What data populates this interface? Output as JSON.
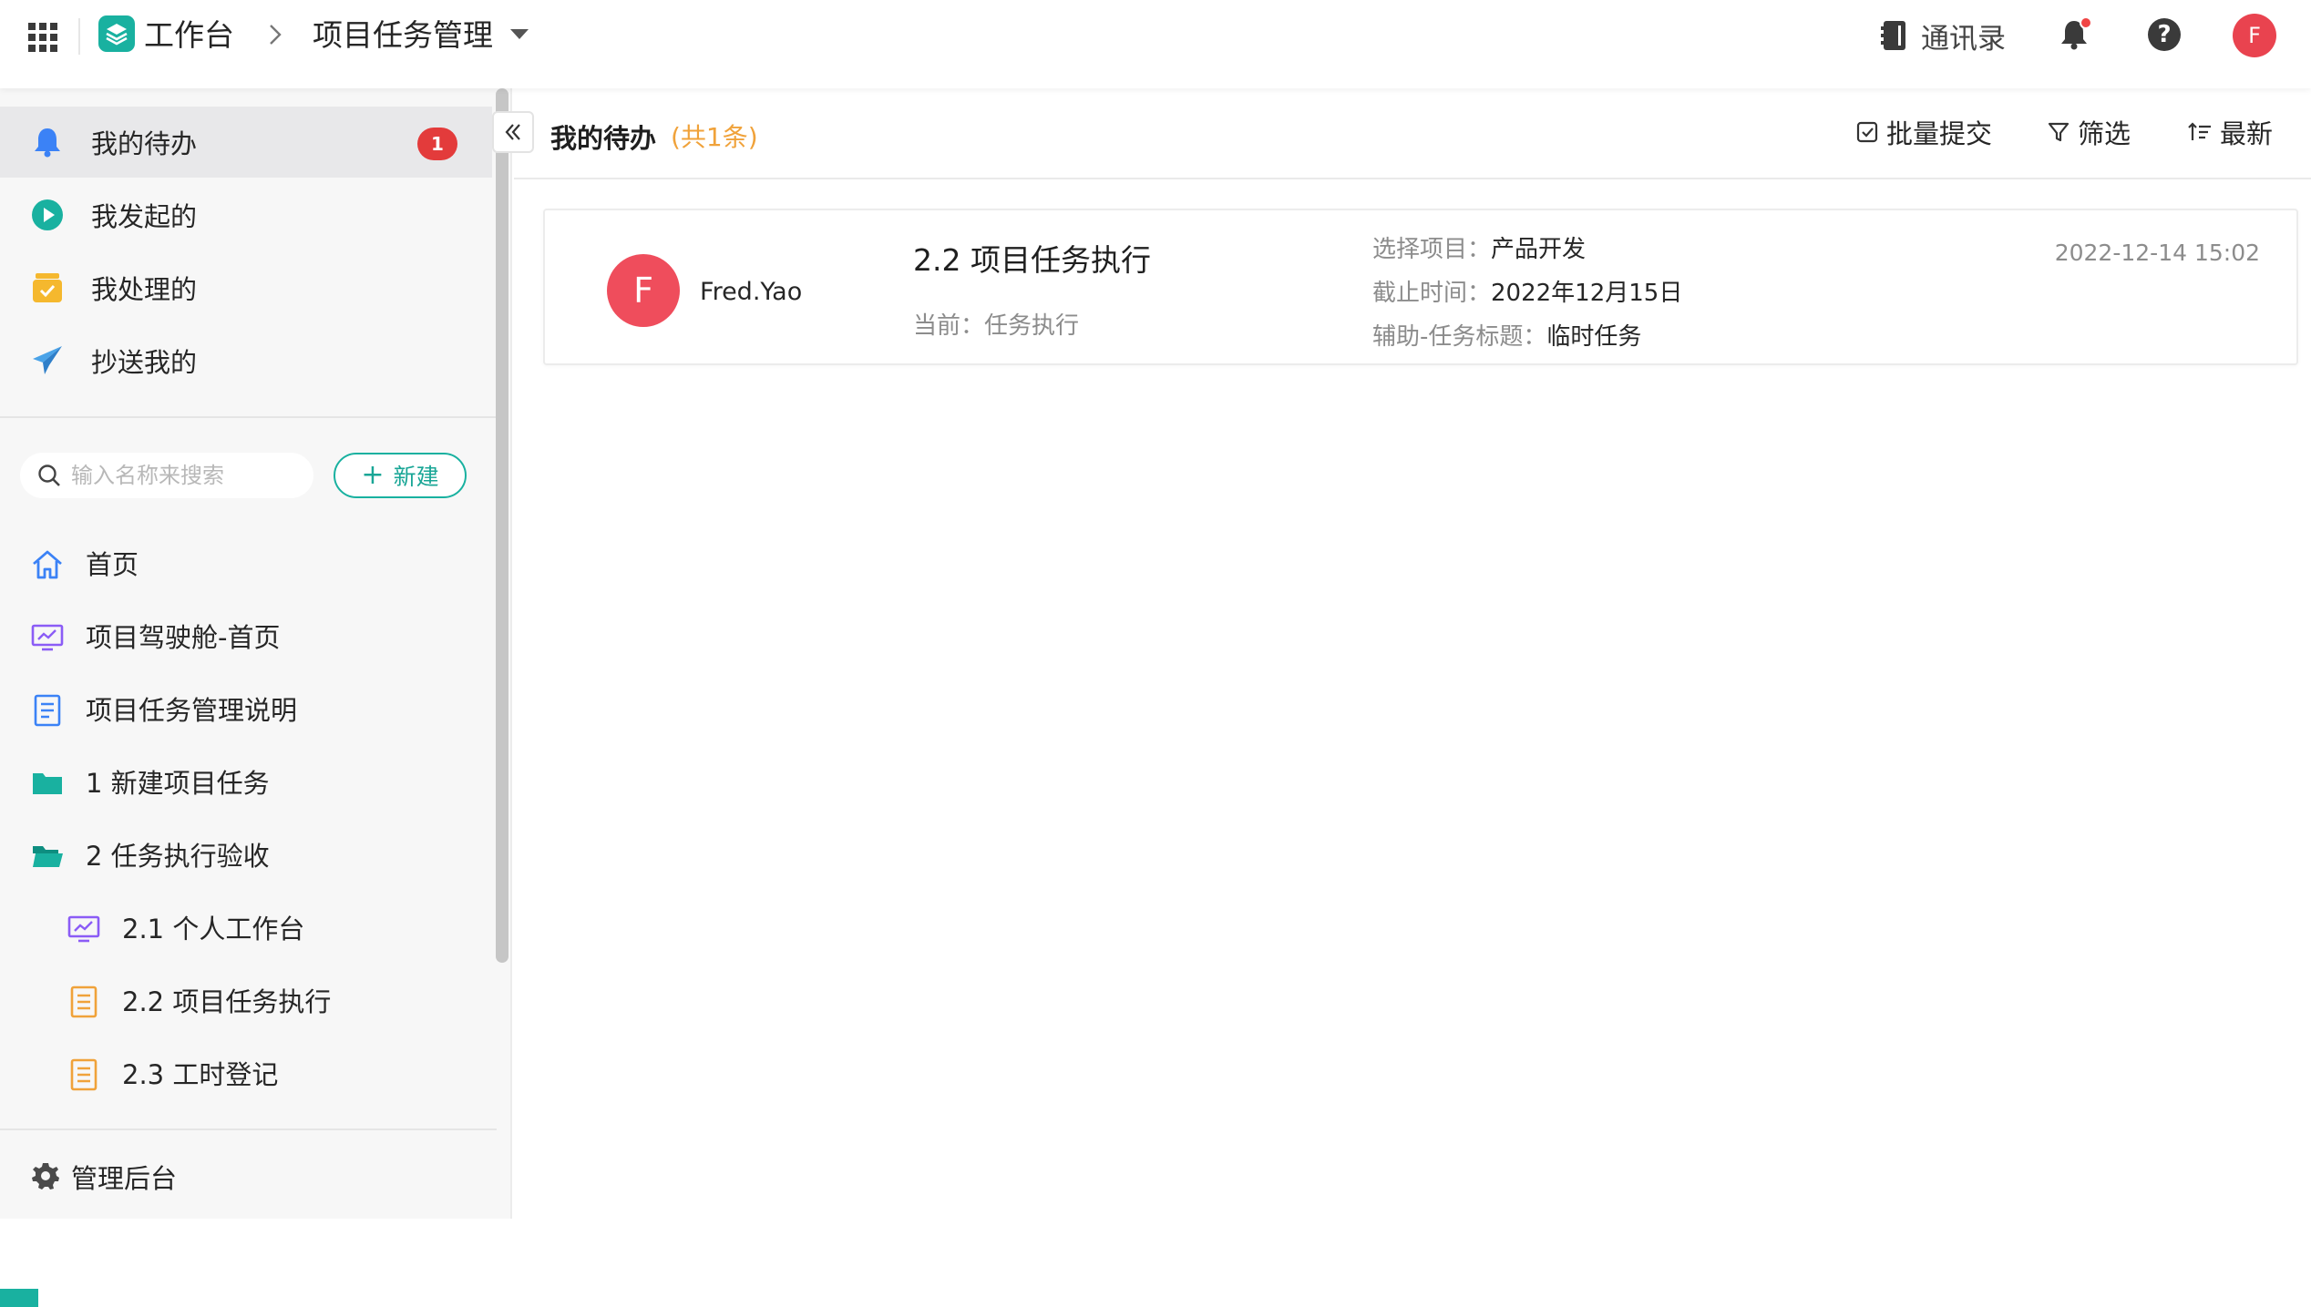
{
  "topbar": {
    "app_name": "工作台",
    "page_name": "项目任务管理",
    "contacts_label": "通讯录",
    "avatar_letter": "F"
  },
  "sidebar": {
    "quick": [
      {
        "label": "我的待办",
        "icon": "bell-icon",
        "badge": "1",
        "active": true
      },
      {
        "label": "我发起的",
        "icon": "play-circle-icon"
      },
      {
        "label": "我处理的",
        "icon": "inbox-check-icon"
      },
      {
        "label": "抄送我的",
        "icon": "paper-plane-icon"
      }
    ],
    "search_placeholder": "输入名称来搜索",
    "new_label": "新建",
    "nav": [
      {
        "label": "首页",
        "icon": "home-icon"
      },
      {
        "label": "项目驾驶舱-首页",
        "icon": "dashboard-icon"
      },
      {
        "label": "项目任务管理说明",
        "icon": "document-icon"
      },
      {
        "label": "1 新建项目任务",
        "icon": "folder-icon"
      },
      {
        "label": "2 任务执行验收",
        "icon": "folder-open-icon"
      },
      {
        "label": "2.1 个人工作台",
        "icon": "dashboard-icon"
      },
      {
        "label": "2.2 项目任务执行",
        "icon": "form-icon"
      },
      {
        "label": "2.3 工时登记",
        "icon": "form-icon"
      }
    ],
    "admin_label": "管理后台"
  },
  "main": {
    "title": "我的待办",
    "count": "(共1条)",
    "actions": {
      "batch_submit": "批量提交",
      "filter": "筛选",
      "sort": "最新"
    },
    "card": {
      "avatar_letter": "F",
      "user": "Fred.Yao",
      "task_title": "2.2 项目任务执行",
      "stage": "当前：任务执行",
      "fields": [
        {
          "key": "选择项目：",
          "value": "产品开发"
        },
        {
          "key": "截止时间：",
          "value": "2022年12月15日"
        },
        {
          "key": "辅助-任务标题：",
          "value": "临时任务"
        }
      ],
      "time": "2022-12-14 15:02"
    }
  },
  "colors": {
    "accent": "#19b1a0",
    "badge": "#e33b3b",
    "avatar": "#ef4d5c",
    "count": "#f0a23a"
  }
}
